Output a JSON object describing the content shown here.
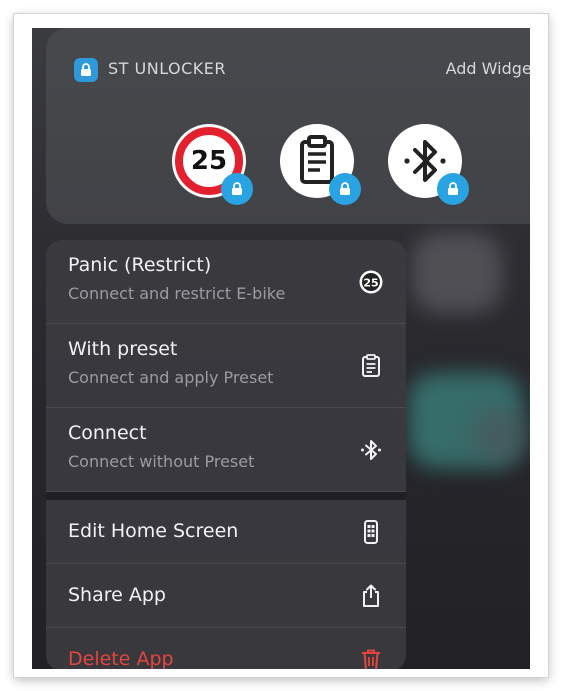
{
  "app": {
    "title": "ST UNLOCKER",
    "add_widget": "Add Widget",
    "logo_icon": "padlock-app-icon"
  },
  "quick_actions": [
    {
      "icon": "speed-limit-25-icon",
      "sign_text": "25",
      "badge_icon": "lock-badge-icon"
    },
    {
      "icon": "clipboard-icon",
      "badge_icon": "lock-badge-icon"
    },
    {
      "icon": "bluetooth-icon",
      "badge_icon": "lock-badge-icon"
    }
  ],
  "menu": {
    "items": [
      {
        "title": "Panic (Restrict)",
        "subtitle": "Connect and restrict E-bike",
        "icon": "speed-limit-25-icon",
        "icon_text": "25"
      },
      {
        "title": "With preset",
        "subtitle": "Connect and apply Preset",
        "icon": "clipboard-icon"
      },
      {
        "title": "Connect",
        "subtitle": "Connect without Preset",
        "icon": "bluetooth-icon"
      }
    ],
    "system_items": [
      {
        "title": "Edit Home Screen",
        "icon": "phone-icon"
      },
      {
        "title": "Share App",
        "icon": "share-icon"
      },
      {
        "title": "Delete App",
        "icon": "trash-icon",
        "destructive": true
      }
    ]
  },
  "colors": {
    "accent_blue": "#2aa3e2",
    "speed_sign_red": "#e3202e",
    "destructive_red": "#e5453f"
  }
}
